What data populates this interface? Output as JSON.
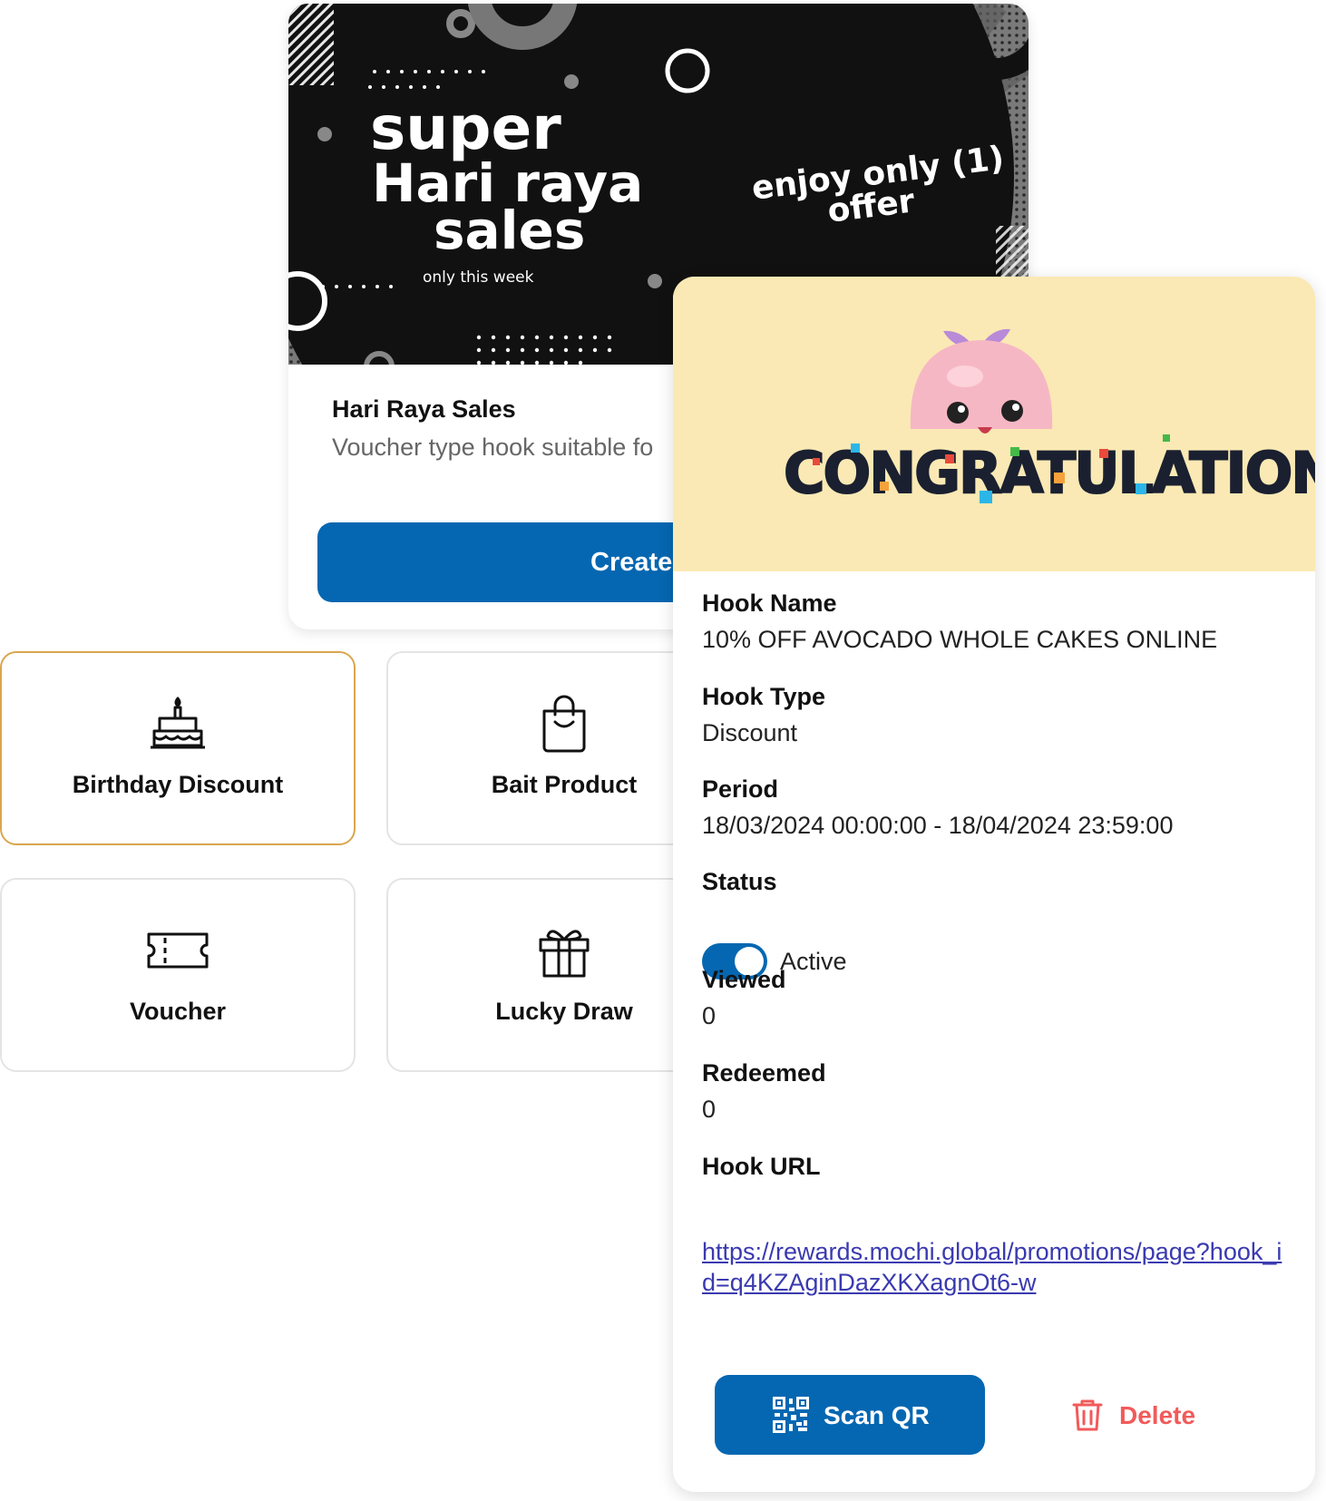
{
  "promo_card": {
    "banner": {
      "headline_1": "super",
      "headline_2": "Hari raya",
      "headline_3": "sales",
      "tagline": "only this week",
      "offer_line_1": "enjoy only (1)",
      "offer_line_2": "offer"
    },
    "title": "Hari Raya Sales",
    "description": "Voucher type hook suitable fo",
    "create_button": "Create New"
  },
  "hook_types": [
    {
      "label": "Birthday Discount",
      "icon": "birthday-cake-icon",
      "selected": true
    },
    {
      "label": "Bait Product",
      "icon": "shopping-bag-icon",
      "selected": false
    },
    {
      "label": "Voucher",
      "icon": "ticket-icon",
      "selected": false
    },
    {
      "label": "Lucky Draw",
      "icon": "gift-icon",
      "selected": false
    }
  ],
  "hook_detail": {
    "banner_text": "CONGRATULATIONS",
    "hook_name_label": "Hook Name",
    "hook_name": "10% OFF AVOCADO WHOLE CAKES ONLINE",
    "hook_type_label": "Hook Type",
    "hook_type": "Discount",
    "period_label": "Period",
    "period": "18/03/2024 00:00:00 - 18/04/2024 23:59:00",
    "status_label": "Status",
    "status": "Active",
    "status_on": true,
    "viewed_label": "Viewed",
    "viewed": "0",
    "redeemed_label": "Redeemed",
    "redeemed": "0",
    "hook_url_label": "Hook URL",
    "hook_url": "https://rewards.mochi.global/promotions/page?hook_id=q4KZAginDazXKXagnOt6-w",
    "scan_qr_button": "Scan QR",
    "delete_button": "Delete"
  },
  "colors": {
    "primary": "#0567b1",
    "selected_border": "#d9a64f",
    "banner_bg": "#fae9b4",
    "delete": "#f25a5a",
    "link": "#3a3ab0"
  }
}
